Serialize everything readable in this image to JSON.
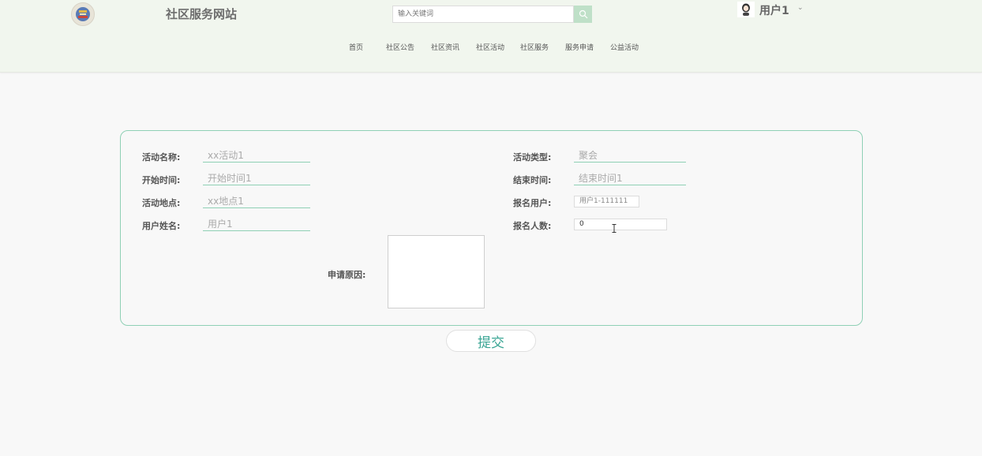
{
  "header": {
    "site_title": "社区服务网站",
    "search_placeholder": "输入关键词",
    "user_name": "用户1",
    "user_caret": "⌄"
  },
  "nav": [
    "首页",
    "社区公告",
    "社区资讯",
    "社区活动",
    "社区服务",
    "服务申请",
    "公益活动"
  ],
  "form": {
    "fields": {
      "activity_name": {
        "label": "活动名称:",
        "value": "xx活动1"
      },
      "start_time": {
        "label": "开始时间:",
        "value": "开始时间1"
      },
      "location": {
        "label": "活动地点:",
        "value": "xx地点1"
      },
      "user_real_name": {
        "label": "用户姓名:",
        "value": "用户1"
      },
      "activity_type": {
        "label": "活动类型:",
        "value": "聚会"
      },
      "end_time": {
        "label": "结束时间:",
        "value": "结束时间1"
      },
      "signup_user": {
        "label": "报名用户:",
        "value": "用户1-111111"
      },
      "signup_count": {
        "label": "报名人数:",
        "value": "0"
      }
    },
    "reason_label": "申请原因:",
    "reason_value": ""
  },
  "submit_label": "提交",
  "colors": {
    "accent": "#8fd0b5",
    "submit_text": "#3aa594",
    "header_bg": "#f1f6ee",
    "search_button": "#bfe0c8"
  },
  "icons": {
    "logo": "community-emblem-icon",
    "search": "search-icon",
    "avatar": "avatar-icon",
    "cursor": "text-cursor-icon"
  }
}
